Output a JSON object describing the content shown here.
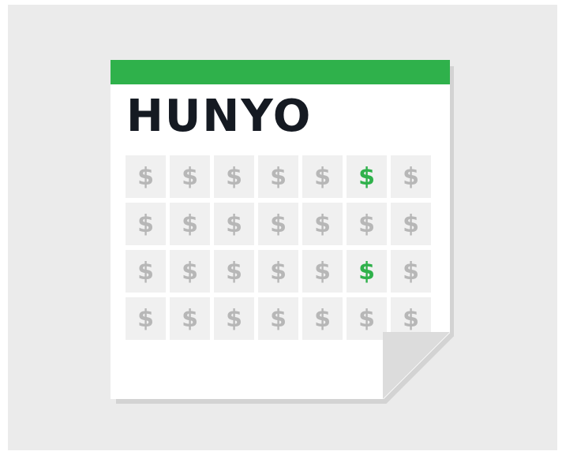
{
  "calendar": {
    "title": "HUNYO",
    "header_color": "#2fb14b",
    "symbol": "$",
    "icon": "dollar-sign-icon",
    "rows": [
      [
        false,
        false,
        false,
        false,
        false,
        true,
        false
      ],
      [
        false,
        false,
        false,
        false,
        false,
        false,
        false
      ],
      [
        false,
        false,
        false,
        false,
        false,
        true,
        false
      ],
      [
        false,
        false,
        false,
        false,
        false,
        false,
        false
      ]
    ]
  }
}
